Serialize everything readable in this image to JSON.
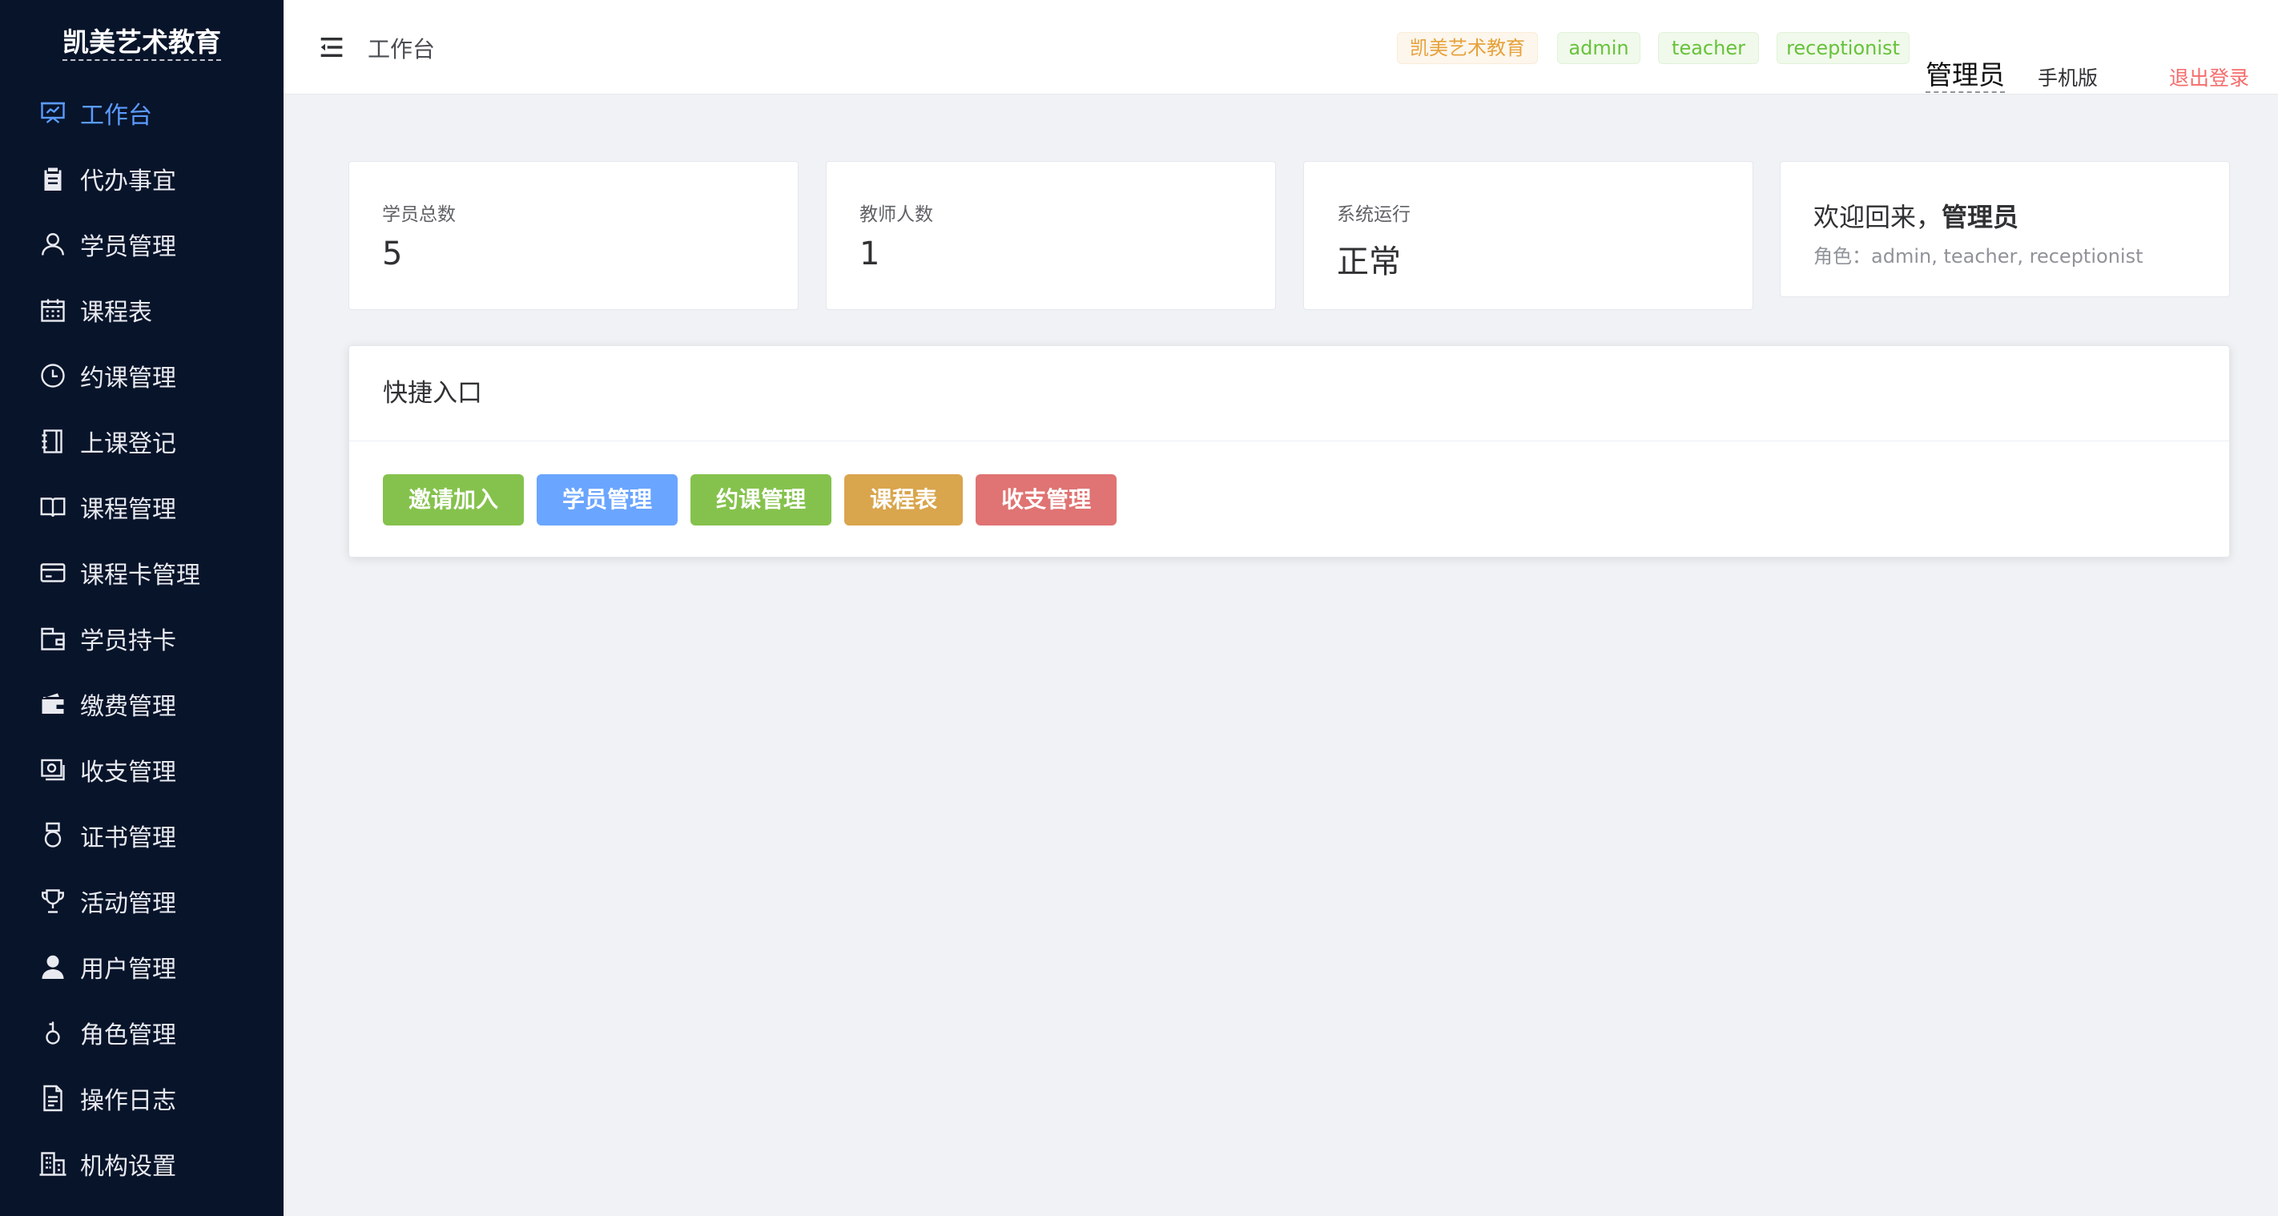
{
  "sidebar": {
    "logo": "凯美艺术教育",
    "items": [
      {
        "label": "工作台",
        "icon": "presentation-icon",
        "active": true
      },
      {
        "label": "代办事宜",
        "icon": "clipboard-icon"
      },
      {
        "label": "学员管理",
        "icon": "user-icon"
      },
      {
        "label": "课程表",
        "icon": "calendar-icon"
      },
      {
        "label": "约课管理",
        "icon": "clock-icon"
      },
      {
        "label": "上课登记",
        "icon": "notebook-icon"
      },
      {
        "label": "课程管理",
        "icon": "book-icon"
      },
      {
        "label": "课程卡管理",
        "icon": "credit-card-icon"
      },
      {
        "label": "学员持卡",
        "icon": "wallet-icon"
      },
      {
        "label": "缴费管理",
        "icon": "wallet-filled-icon"
      },
      {
        "label": "收支管理",
        "icon": "money-icon"
      },
      {
        "label": "证书管理",
        "icon": "medal-icon"
      },
      {
        "label": "活动管理",
        "icon": "trophy-icon"
      },
      {
        "label": "用户管理",
        "icon": "user-filled-icon"
      },
      {
        "label": "角色管理",
        "icon": "key-icon"
      },
      {
        "label": "操作日志",
        "icon": "document-icon"
      },
      {
        "label": "机构设置",
        "icon": "office-building-icon"
      }
    ]
  },
  "header": {
    "breadcrumb": "工作台",
    "tags": {
      "org": "凯美艺术教育",
      "admin": "admin",
      "teacher": "teacher",
      "receptionist": "receptionist"
    },
    "username": "管理员",
    "mobile": "手机版",
    "logout": "退出登录"
  },
  "stats": {
    "students": {
      "label": "学员总数",
      "value": "5"
    },
    "teachers": {
      "label": "教师人数",
      "value": "1"
    },
    "system": {
      "label": "系统运行",
      "value": "正常"
    }
  },
  "welcome": {
    "prefix": "欢迎回来，",
    "name": "管理员",
    "roles": "角色：admin, teacher, receptionist"
  },
  "quick": {
    "title": "快捷入口",
    "buttons": {
      "invite": "邀请加入",
      "students": "学员管理",
      "booking": "约课管理",
      "schedule": "课程表",
      "finance": "收支管理"
    }
  },
  "colors": {
    "sidebar_bg": "#08142a",
    "active": "#5b9bff",
    "green": "#85c24d",
    "blue": "#6aa5ff",
    "orange": "#d9a54d",
    "red": "#e07373"
  }
}
